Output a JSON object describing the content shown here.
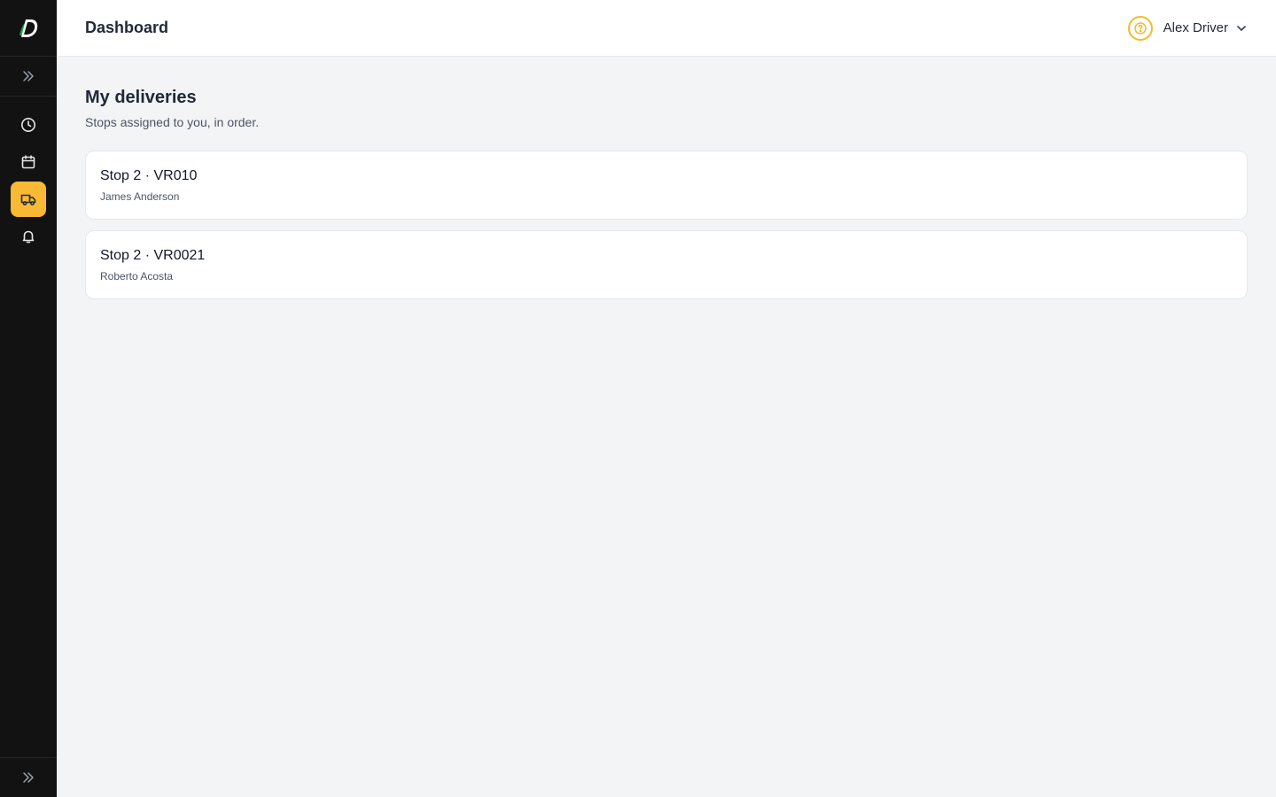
{
  "app": {
    "logo_icon": "brand-d-logo-icon",
    "accent_color": "#f9b934"
  },
  "sidebar": {
    "expand_icon": "double-chevron-right-icon",
    "items": [
      {
        "icon": "clock-icon",
        "active": false
      },
      {
        "icon": "calendar-icon",
        "active": false
      },
      {
        "icon": "truck-icon",
        "active": true
      },
      {
        "icon": "bell-icon",
        "active": false
      }
    ]
  },
  "header": {
    "title": "Dashboard",
    "help_icon": "help-circle-icon",
    "user_name": "Alex Driver",
    "user_menu_icon": "chevron-down-icon"
  },
  "main": {
    "title": "My deliveries",
    "subtitle": "Stops assigned to you, in order.",
    "deliveries": [
      {
        "title": "Stop 2 · VR010",
        "customer": "James Anderson"
      },
      {
        "title": "Stop 2 · VR0021",
        "customer": "Roberto Acosta"
      }
    ]
  }
}
